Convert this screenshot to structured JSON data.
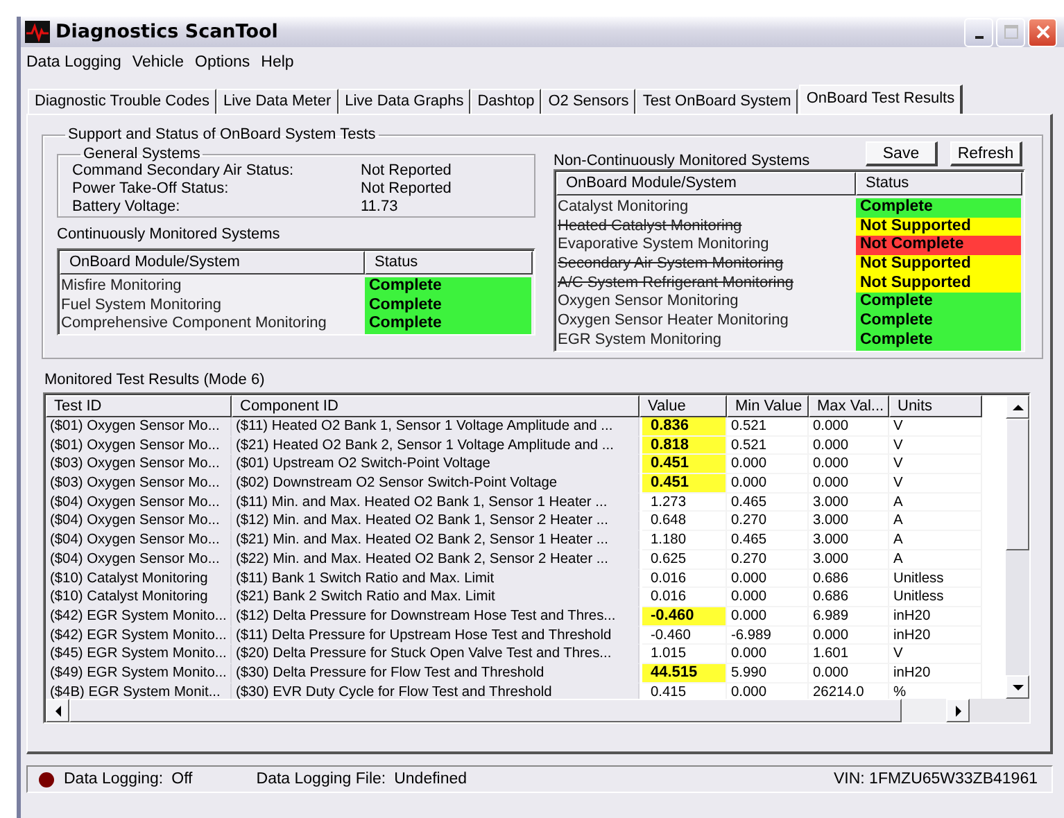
{
  "window": {
    "title": "Diagnostics ScanTool"
  },
  "menu": [
    "Data Logging",
    "Vehicle",
    "Options",
    "Help"
  ],
  "tabs": [
    {
      "label": "Diagnostic Trouble Codes",
      "selected": false
    },
    {
      "label": "Live Data Meter",
      "selected": false
    },
    {
      "label": "Live Data Graphs",
      "selected": false
    },
    {
      "label": "Dashtop",
      "selected": false
    },
    {
      "label": "O2 Sensors",
      "selected": false
    },
    {
      "label": "Test OnBoard System",
      "selected": false
    },
    {
      "label": "OnBoard Test Results",
      "selected": true
    }
  ],
  "support_group": {
    "title": "Support and Status of OnBoard System Tests",
    "general_systems": {
      "title": "General Systems",
      "items": [
        {
          "label": "Command Secondary Air Status:",
          "value": "Not Reported"
        },
        {
          "label": "Power Take-Off Status:",
          "value": "Not Reported"
        },
        {
          "label": "Battery Voltage:",
          "value": "11.73"
        }
      ]
    },
    "continuous": {
      "title": "Continuously Monitored Systems",
      "columns": [
        "OnBoard Module/System",
        "Status"
      ],
      "rows": [
        {
          "system": "Misfire Monitoring",
          "supported": true,
          "status": "Complete",
          "kind": "complete"
        },
        {
          "system": "Fuel System Monitoring",
          "supported": true,
          "status": "Complete",
          "kind": "complete"
        },
        {
          "system": "Comprehensive Component Monitoring",
          "supported": true,
          "status": "Complete",
          "kind": "complete"
        }
      ]
    },
    "buttons": [
      "Save",
      "Refresh"
    ],
    "non_continuous": {
      "title": "Non-Continuously Monitored Systems",
      "columns": [
        "OnBoard Module/System",
        "Status"
      ],
      "rows": [
        {
          "system": "Catalyst Monitoring",
          "supported": true,
          "status": "Complete",
          "kind": "complete"
        },
        {
          "system": "Heated Catalyst Monitoring",
          "supported": false,
          "status": "Not Supported",
          "kind": "not_supported"
        },
        {
          "system": "Evaporative System Monitoring",
          "supported": true,
          "status": "Not Complete",
          "kind": "not_complete"
        },
        {
          "system": "Secondary Air System Monitoring",
          "supported": false,
          "status": "Not Supported",
          "kind": "not_supported"
        },
        {
          "system": "A/C System Refrigerant Monitoring",
          "supported": false,
          "status": "Not Supported",
          "kind": "not_supported"
        },
        {
          "system": "Oxygen Sensor Monitoring",
          "supported": true,
          "status": "Complete",
          "kind": "complete"
        },
        {
          "system": "Oxygen Sensor Heater Monitoring",
          "supported": true,
          "status": "Complete",
          "kind": "complete"
        },
        {
          "system": "EGR System Monitoring",
          "supported": true,
          "status": "Complete",
          "kind": "complete"
        }
      ]
    }
  },
  "results": {
    "title": "Monitored Test Results (Mode 6)",
    "columns": [
      "Test ID",
      "Component ID",
      "Value",
      "Min Value",
      "Max Val...",
      "Units"
    ],
    "rows": [
      {
        "cells": [
          "($01)  Oxygen Sensor Mo...",
          "($11)  Heated O2 Bank 1, Sensor 1 Voltage Amplitude and ...",
          "0.836",
          "0.521",
          "0.000",
          "V"
        ],
        "highlighted": true
      },
      {
        "cells": [
          "($01)  Oxygen Sensor Mo...",
          "($21)  Heated O2 Bank 2, Sensor 1 Voltage Amplitude and ...",
          "0.818",
          "0.521",
          "0.000",
          "V"
        ],
        "highlighted": true
      },
      {
        "cells": [
          "($03)  Oxygen Sensor Mo...",
          "($01)  Upstream O2 Switch-Point Voltage",
          "0.451",
          "0.000",
          "0.000",
          "V"
        ],
        "highlighted": true
      },
      {
        "cells": [
          "($03)  Oxygen Sensor Mo...",
          "($02)  Downstream O2 Sensor Switch-Point Voltage",
          "0.451",
          "0.000",
          "0.000",
          "V"
        ],
        "highlighted": true
      },
      {
        "cells": [
          "($04)  Oxygen Sensor Mo...",
          "($11)  Min. and Max. Heated O2 Bank 1, Sensor 1 Heater ...",
          "1.273",
          "0.465",
          "3.000",
          "A"
        ],
        "highlighted": false
      },
      {
        "cells": [
          "($04)  Oxygen Sensor Mo...",
          "($12)  Min. and Max. Heated O2 Bank 1, Sensor 2 Heater ...",
          "0.648",
          "0.270",
          "3.000",
          "A"
        ],
        "highlighted": false
      },
      {
        "cells": [
          "($04)  Oxygen Sensor Mo...",
          "($21)  Min. and Max. Heated O2 Bank 2, Sensor 1 Heater ...",
          "1.180",
          "0.465",
          "3.000",
          "A"
        ],
        "highlighted": false
      },
      {
        "cells": [
          "($04)  Oxygen Sensor Mo...",
          "($22)  Min. and Max. Heated O2 Bank 2, Sensor 2 Heater ...",
          "0.625",
          "0.270",
          "3.000",
          "A"
        ],
        "highlighted": false
      },
      {
        "cells": [
          "($10)  Catalyst Monitoring",
          "($11)  Bank 1 Switch Ratio and Max. Limit",
          "0.016",
          "0.000",
          "0.686",
          "Unitless"
        ],
        "highlighted": false
      },
      {
        "cells": [
          "($10)  Catalyst Monitoring",
          "($21)  Bank 2 Switch Ratio and Max. Limit",
          "0.016",
          "0.000",
          "0.686",
          "Unitless"
        ],
        "highlighted": false
      },
      {
        "cells": [
          "($42)  EGR System Monito...",
          "($12)  Delta Pressure for Downstream Hose Test and Thres...",
          "-0.460",
          "0.000",
          "6.989",
          "inH20"
        ],
        "highlighted": true
      },
      {
        "cells": [
          "($42)  EGR System Monito...",
          "($11)  Delta Pressure for Upstream Hose Test and Threshold",
          "-0.460",
          "-6.989",
          "0.000",
          "inH20"
        ],
        "highlighted": false
      },
      {
        "cells": [
          "($45)  EGR System Monito...",
          "($20)  Delta Pressure for Stuck Open Valve Test and Thres...",
          "1.015",
          "0.000",
          "1.601",
          "V"
        ],
        "highlighted": false
      },
      {
        "cells": [
          "($49)  EGR System Monito...",
          "($30)  Delta Pressure for Flow Test and Threshold",
          "44.515",
          "5.990",
          "0.000",
          "inH20"
        ],
        "highlighted": true
      },
      {
        "cells": [
          "($4B)  EGR System Monit...",
          "($30)  EVR Duty Cycle for Flow Test and Threshold",
          "0.415",
          "0.000",
          "26214.0",
          "%"
        ],
        "highlighted": false
      }
    ]
  },
  "status_bar": {
    "logging_label": "Data Logging:",
    "logging_value": "Off",
    "logging_on": false,
    "file_label": "Data Logging File:",
    "file_value": "Undefined",
    "vin": "VIN:  1FMZU65W33ZB41961"
  }
}
